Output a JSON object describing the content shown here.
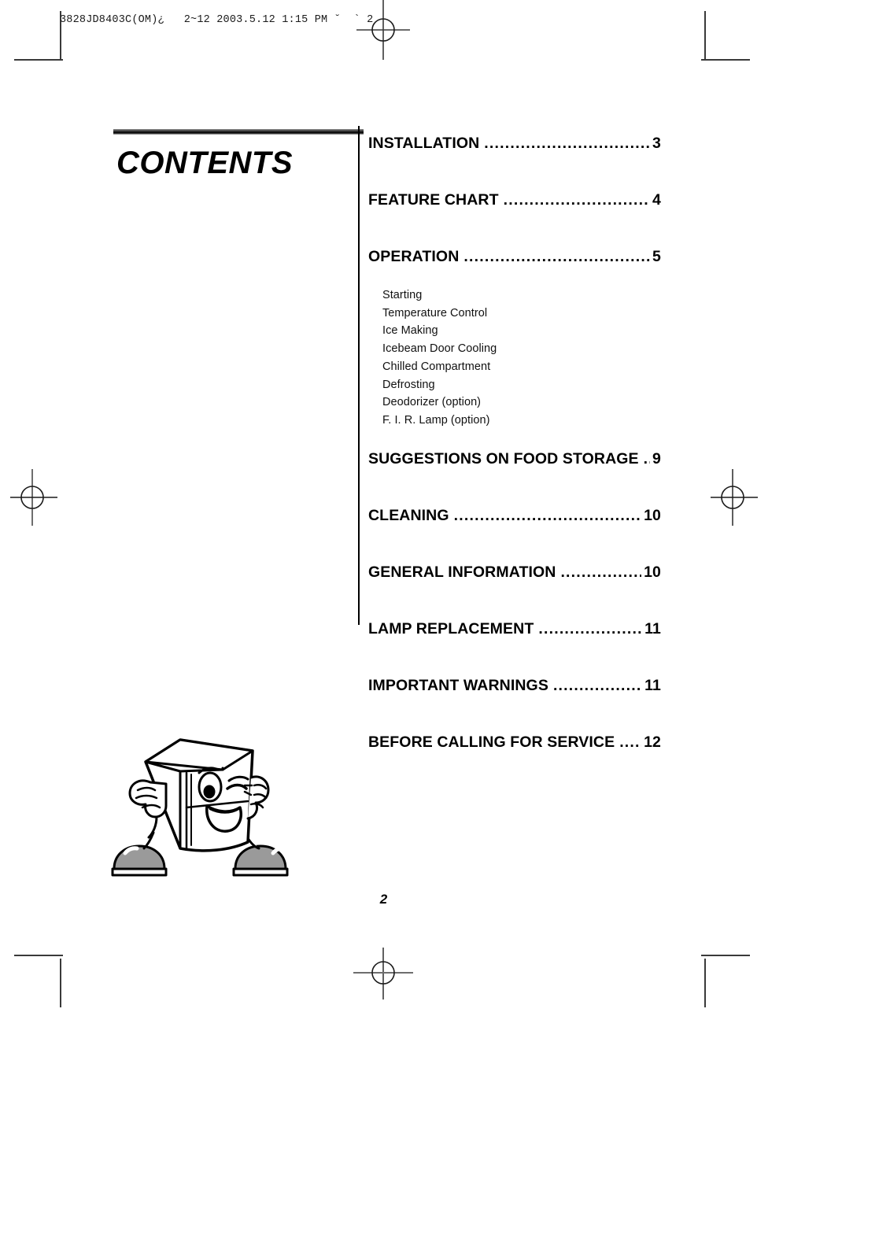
{
  "document": {
    "prepress_slug": "3828JD8403C(OM)¿   2~12 2003.5.12 1:15 PM ˘  ` 2",
    "page_number": "2",
    "title": "CONTENTS"
  },
  "toc": {
    "entries": [
      {
        "label": "INSTALLATION",
        "dots": "........................................",
        "page": "3"
      },
      {
        "label": "FEATURE CHART",
        "dots": "...................................",
        "page": "4"
      },
      {
        "label": "OPERATION",
        "dots": "..............................................",
        "page": "5"
      },
      {
        "label": "SUGGESTIONS ON FOOD STORAGE",
        "dots": "....",
        "page": "9"
      },
      {
        "label": "CLEANING",
        "dots": "...............................................",
        "page": "10"
      },
      {
        "label": "GENERAL INFORMATION",
        "dots": ".......................",
        "page": "10"
      },
      {
        "label": "LAMP REPLACEMENT",
        "dots": "...........................",
        "page": "11"
      },
      {
        "label": "IMPORTANT WARNINGS",
        "dots": "........................",
        "page": "11"
      },
      {
        "label": "BEFORE CALLING FOR SERVICE",
        "dots": ".........",
        "page": "12"
      }
    ],
    "operation_subitems": [
      "Starting",
      "Temperature Control",
      "Ice Making",
      "Icebeam Door Cooling",
      "Chilled Compartment",
      "Defrosting",
      "Deodorizer (option)",
      "F. I. R. Lamp (option)"
    ]
  },
  "artwork": {
    "mascot_name": "refrigerator-mascot"
  },
  "colors": {
    "ink": "#000000",
    "mark": "#3a3a3a",
    "mascot_shade": "#9a9a9a"
  }
}
